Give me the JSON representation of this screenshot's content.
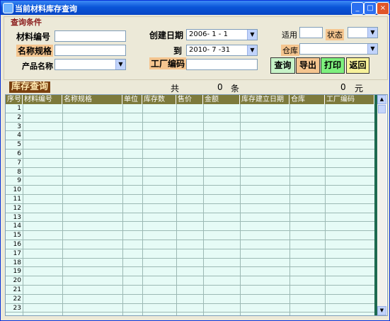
{
  "window": {
    "title": "当前材料库存查询",
    "min_glyph": "_",
    "max_glyph": "□",
    "close_glyph": "×"
  },
  "filters": {
    "group_title": "查询条件",
    "material_code_label": "材料编号",
    "material_code_value": "",
    "name_spec_label": "名称规格",
    "name_spec_value": "",
    "product_name_label": "产品名称",
    "product_name_value": "",
    "create_date_label": "创建日期",
    "create_date_from": "2006- 1 - 1",
    "to_label": "到",
    "create_date_to": "2010- 7 -31",
    "factory_code_label": "工厂编码",
    "factory_code_value": "",
    "applicable_label": "适用",
    "applicable_value": "",
    "status_label": "状态",
    "status_value": "",
    "warehouse_label": "仓库",
    "warehouse_value": ""
  },
  "actions": {
    "query": "查询",
    "export": "导出",
    "print": "打印",
    "back": "返回"
  },
  "summary": {
    "section_title": "库存查询",
    "total_prefix": "共",
    "record_count": "0",
    "count_unit": "条",
    "amount": "0",
    "amount_unit": "元"
  },
  "grid": {
    "columns": [
      "序号",
      "材料编号",
      "名称规格",
      "单位",
      "库存数",
      "售价",
      "金额",
      "库存建立日期",
      "仓库",
      "工厂编码"
    ],
    "row_numbers": [
      "1",
      "2",
      "3",
      "4",
      "5",
      "6",
      "7",
      "8",
      "9",
      "10",
      "11",
      "12",
      "13",
      "14",
      "15",
      "16",
      "17",
      "18",
      "19",
      "20",
      "21",
      "22",
      "23"
    ]
  },
  "colors": {
    "title_bar": "#0a55d8",
    "grid_header": "#7d7a3c",
    "grid_body": "#e6fbf6",
    "query_button": "#c7f3c8",
    "export_button": "#f5c58f",
    "print_button": "#7df07d",
    "back_button": "#f8f29a"
  }
}
